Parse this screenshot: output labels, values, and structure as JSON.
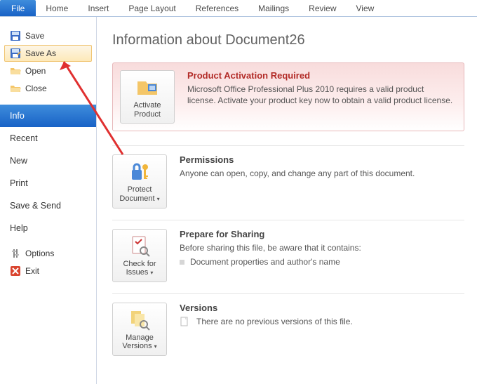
{
  "ribbon": {
    "file": "File",
    "home": "Home",
    "insert": "Insert",
    "pagelayout": "Page Layout",
    "references": "References",
    "mailings": "Mailings",
    "review": "Review",
    "view": "View"
  },
  "sidebar": {
    "save": "Save",
    "saveas": "Save As",
    "open": "Open",
    "close": "Close",
    "info": "Info",
    "recent": "Recent",
    "new": "New",
    "print": "Print",
    "savesend": "Save & Send",
    "help": "Help",
    "options": "Options",
    "exit": "Exit"
  },
  "page": {
    "title": "Information about Document26"
  },
  "activation": {
    "button": "Activate Product",
    "heading": "Product Activation Required",
    "text": "Microsoft Office Professional Plus 2010 requires a valid product license. Activate your product key now to obtain a valid product license."
  },
  "permissions": {
    "button": "Protect Document",
    "heading": "Permissions",
    "text": "Anyone can open, copy, and change any part of this document."
  },
  "prepare": {
    "button": "Check for Issues",
    "heading": "Prepare for Sharing",
    "text": "Before sharing this file, be aware that it contains:",
    "bullet1": "Document properties and author's name"
  },
  "versions": {
    "button": "Manage Versions",
    "heading": "Versions",
    "text": "There are no previous versions of this file."
  }
}
